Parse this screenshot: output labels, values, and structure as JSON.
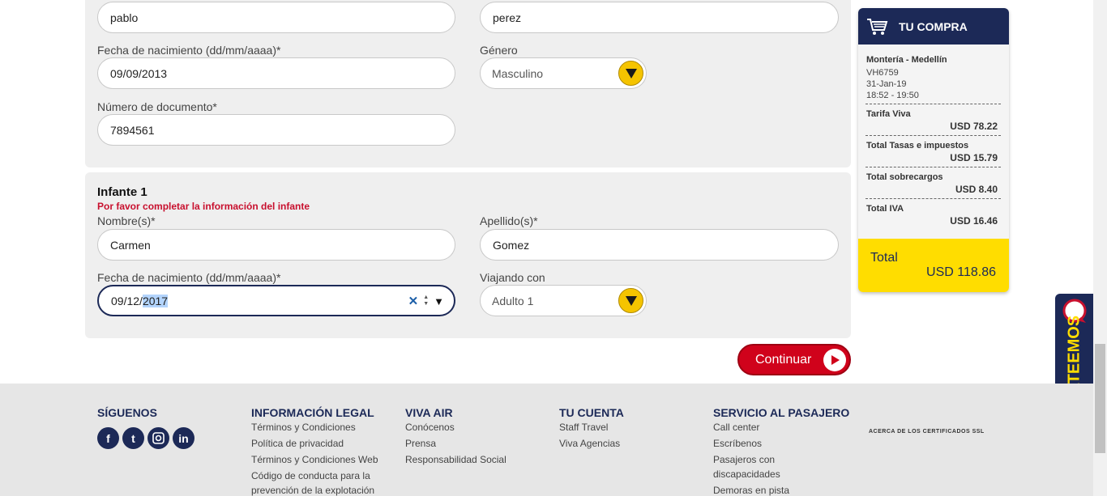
{
  "top_form": {
    "first_name_value": "pablo",
    "last_name_value": "perez",
    "birth_label": "Fecha de nacimiento (dd/mm/aaaa)*",
    "birth_value": "09/09/2013",
    "gender_label": "Género",
    "gender_value": "Masculino",
    "document_label": "Número de documento*",
    "document_value": "7894561"
  },
  "infant": {
    "title": "Infante 1",
    "warning": "Por favor completar la información del infante",
    "name_label": "Nombre(s)*",
    "name_value": "Carmen",
    "surname_label": "Apellido(s)*",
    "surname_value": "Gomez",
    "birth_label": "Fecha de nacimiento (dd/mm/aaaa)*",
    "birth_day_month": "09/12/",
    "birth_year_selected": "2017",
    "traveling_with_label": "Viajando con",
    "traveling_with_value": "Adulto 1"
  },
  "continue_label": "Continuar",
  "cart": {
    "title": "TU COMPRA",
    "route": "Montería - Medellín",
    "flight": "VH6759",
    "date": "31-Jan-19",
    "time": "18:52 - 19:50",
    "items": [
      {
        "label": "Tarifa Viva",
        "value": "USD 78.22"
      },
      {
        "label": "Total Tasas e impuestos",
        "value": "USD 15.79"
      },
      {
        "label": "Total sobrecargos",
        "value": "USD 8.40"
      },
      {
        "label": "Total IVA",
        "value": "USD 16.46"
      }
    ],
    "total_label": "Total",
    "total_value": "USD 118.86"
  },
  "chat_label": "CHATEEMOS",
  "footer": {
    "follow": {
      "heading": "SÍGUENOS",
      "icons": [
        "facebook-icon",
        "twitter-icon",
        "instagram-icon",
        "linkedin-icon"
      ]
    },
    "legal": {
      "heading": "INFORMACIÓN LEGAL",
      "links": [
        "Términos y Condiciones",
        "Política de privacidad",
        "Términos y Condiciones Web",
        "Código de conducta para la",
        "prevención de la explotación"
      ]
    },
    "viva_air": {
      "heading": "VIVA AIR",
      "links": [
        "Conócenos",
        "Prensa",
        "Responsabilidad Social"
      ]
    },
    "account": {
      "heading": "TU CUENTA",
      "links": [
        "Staff Travel",
        "Viva Agencias"
      ]
    },
    "service": {
      "heading": "SERVICIO AL PASAJERO",
      "links": [
        "Call center",
        "Escríbenos",
        "Pasajeros con",
        "discapacidades",
        "Demoras en pista"
      ]
    },
    "ssl": "ACERCA DE LOS CERTIFICADOS SSL"
  },
  "colors": {
    "brand_navy": "#1c2957",
    "brand_yellow": "#ffdd00",
    "alert_red": "#c8102e",
    "button_red": "#d0021b"
  }
}
